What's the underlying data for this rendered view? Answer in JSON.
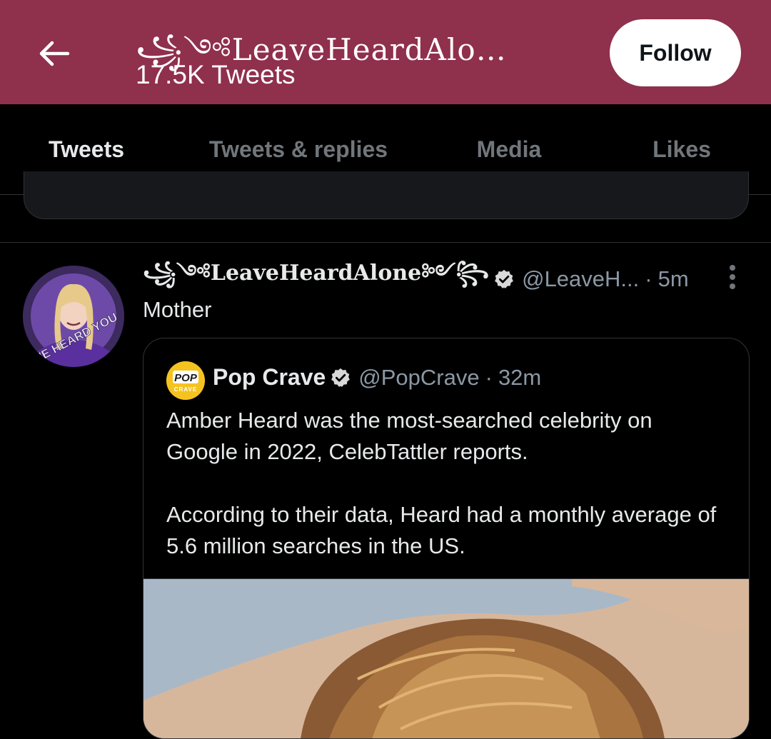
{
  "header": {
    "profile_name": "꧁༺LeaveHeardAlo…",
    "tweet_count": "17.5K Tweets",
    "follow_label": "Follow",
    "background_color": "#8f304d"
  },
  "tabs": [
    {
      "label": "Tweets",
      "active": true
    },
    {
      "label": "Tweets & replies",
      "active": false
    },
    {
      "label": "Media",
      "active": false
    },
    {
      "label": "Likes",
      "active": false
    }
  ],
  "tweet": {
    "display_name": "꧁༺LeaveHeardAlone༻꧂",
    "verified": true,
    "handle": "@LeaveH...",
    "separator": "·",
    "time": "5m",
    "text": "Mother",
    "avatar_text": "WE HEARD YOU",
    "quote": {
      "avatar_text_top": "POP",
      "avatar_text_bottom": "CRAVE",
      "display_name": "Pop Crave",
      "verified": true,
      "handle": "@PopCrave",
      "separator": "·",
      "time": "32m",
      "paragraphs": [
        "Amber Heard was the most-searched celebrity on Google in 2022, CelebTattler reports.",
        "According to their data, Heard had a monthly average of 5.6 million searches in the US."
      ]
    }
  },
  "icons": {
    "back": "arrow-left-icon",
    "verified": "verified-badge-icon",
    "more": "more-vertical-icon"
  },
  "colors": {
    "accent": "#1d9bf0",
    "background": "#000000",
    "text_primary": "#e7e9ea",
    "text_secondary": "#71767b"
  }
}
